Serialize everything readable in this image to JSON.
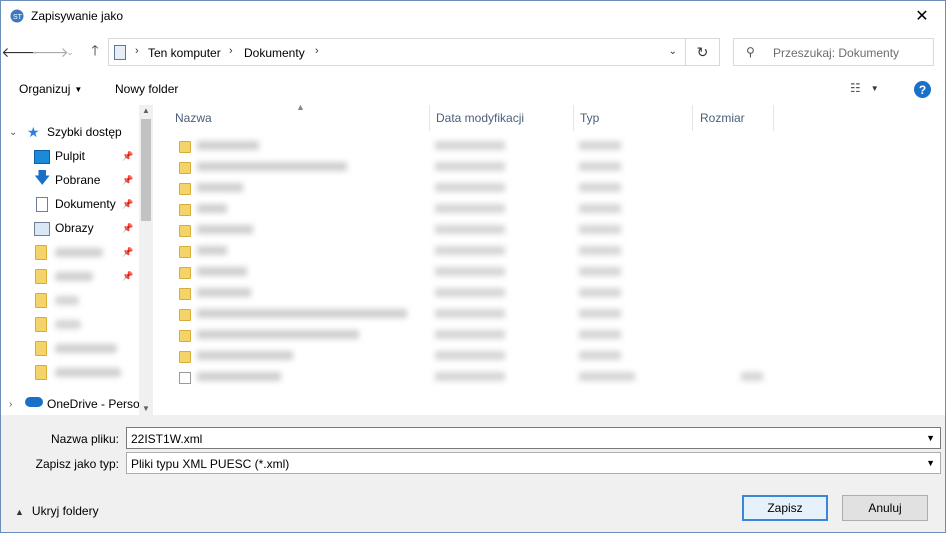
{
  "window": {
    "title": "Zapisywanie jako",
    "close_glyph": "✕"
  },
  "address": {
    "crumbs": [
      "Ten komputer",
      "Dokumenty"
    ],
    "search_placeholder": "Przeszukaj: Dokumenty"
  },
  "toolbar": {
    "organize_label": "Organizuj",
    "new_folder_label": "Nowy folder",
    "help_label": "?"
  },
  "navpane": {
    "items": [
      {
        "label": "Szybki dostęp",
        "icon": "star-icon"
      },
      {
        "label": "Pulpit",
        "icon": "desktop-icon",
        "pinned": true
      },
      {
        "label": "Pobrane",
        "icon": "download-icon",
        "pinned": true
      },
      {
        "label": "Dokumenty",
        "icon": "documents-icon",
        "pinned": true
      },
      {
        "label": "Obrazy",
        "icon": "pictures-icon",
        "pinned": true
      },
      {
        "label": "OneDrive - Perso",
        "icon": "cloud-icon"
      }
    ]
  },
  "columns": {
    "name": "Nazwa",
    "date": "Data modyfikacji",
    "type": "Typ",
    "size": "Rozmiar"
  },
  "bottom": {
    "filename_label": "Nazwa pliku:",
    "filename_value": "22IST1W.xml",
    "filetype_label": "Zapisz jako typ:",
    "filetype_value": "Pliki typu XML PUESC (*.xml)",
    "hide_folders_label": "Ukryj foldery",
    "save_label": "Zapisz",
    "cancel_label": "Anuluj"
  },
  "colors": {
    "accent": "#1a6fc9",
    "folder": "#f5d36b",
    "save_border": "#3c86d7"
  }
}
